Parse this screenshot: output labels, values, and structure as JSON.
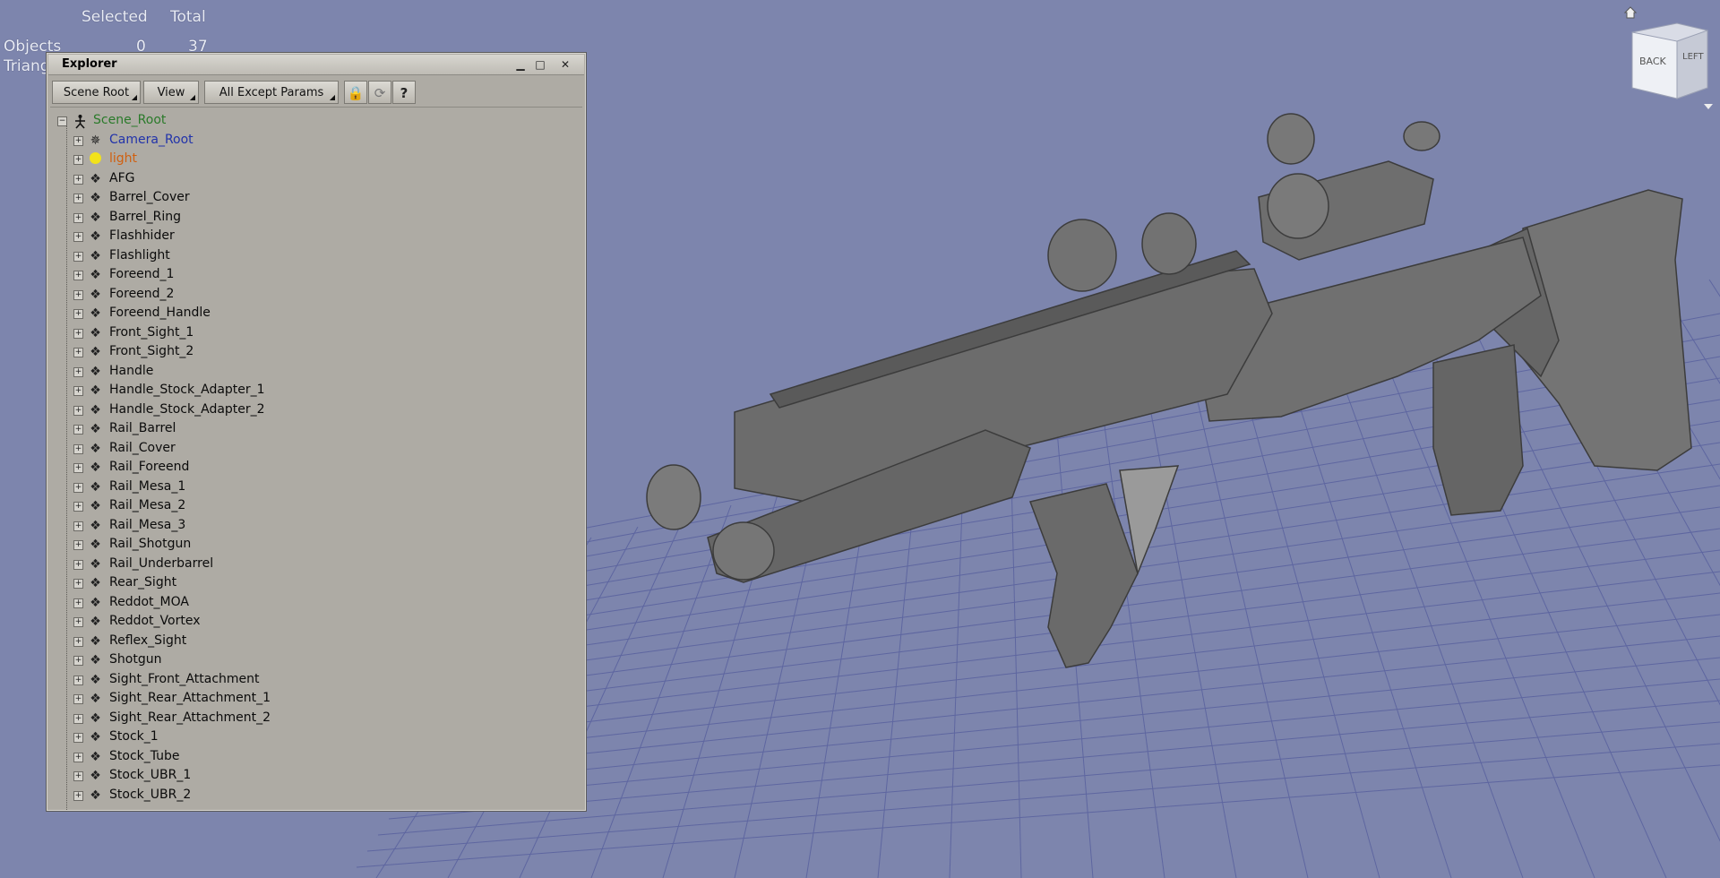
{
  "stats": {
    "col_selected": "Selected",
    "col_total": "Total",
    "objects_label": "Objects",
    "objects_selected": "0",
    "objects_total": "37",
    "triangles_label": "Triang"
  },
  "navcube": {
    "face_back": "BACK",
    "face_left": "LEFT"
  },
  "explorer": {
    "title": "Explorer",
    "toolbar": {
      "scene_root": "Scene Root",
      "view": "View",
      "filter": "All Except Params"
    },
    "root": {
      "label": "Scene_Root",
      "color": "#2a7a2a"
    },
    "items": [
      {
        "label": "Camera_Root",
        "kind": "camera",
        "color": "#2233aa"
      },
      {
        "label": "light",
        "kind": "light",
        "color": "#d06010"
      },
      {
        "label": "AFG",
        "kind": "mesh"
      },
      {
        "label": "Barrel_Cover",
        "kind": "mesh"
      },
      {
        "label": "Barrel_Ring",
        "kind": "mesh"
      },
      {
        "label": "Flashhider",
        "kind": "mesh"
      },
      {
        "label": "Flashlight",
        "kind": "mesh"
      },
      {
        "label": "Foreend_1",
        "kind": "mesh"
      },
      {
        "label": "Foreend_2",
        "kind": "mesh"
      },
      {
        "label": "Foreend_Handle",
        "kind": "mesh"
      },
      {
        "label": "Front_Sight_1",
        "kind": "mesh"
      },
      {
        "label": "Front_Sight_2",
        "kind": "mesh"
      },
      {
        "label": "Handle",
        "kind": "mesh"
      },
      {
        "label": "Handle_Stock_Adapter_1",
        "kind": "mesh"
      },
      {
        "label": "Handle_Stock_Adapter_2",
        "kind": "mesh"
      },
      {
        "label": "Rail_Barrel",
        "kind": "mesh"
      },
      {
        "label": "Rail_Cover",
        "kind": "mesh"
      },
      {
        "label": "Rail_Foreend",
        "kind": "mesh"
      },
      {
        "label": "Rail_Mesa_1",
        "kind": "mesh"
      },
      {
        "label": "Rail_Mesa_2",
        "kind": "mesh"
      },
      {
        "label": "Rail_Mesa_3",
        "kind": "mesh"
      },
      {
        "label": "Rail_Shotgun",
        "kind": "mesh"
      },
      {
        "label": "Rail_Underbarrel",
        "kind": "mesh"
      },
      {
        "label": "Rear_Sight",
        "kind": "mesh"
      },
      {
        "label": "Reddot_MOA",
        "kind": "mesh"
      },
      {
        "label": "Reddot_Vortex",
        "kind": "mesh"
      },
      {
        "label": "Reflex_Sight",
        "kind": "mesh"
      },
      {
        "label": "Shotgun",
        "kind": "mesh"
      },
      {
        "label": "Sight_Front_Attachment",
        "kind": "mesh"
      },
      {
        "label": "Sight_Rear_Attachment_1",
        "kind": "mesh"
      },
      {
        "label": "Sight_Rear_Attachment_2",
        "kind": "mesh"
      },
      {
        "label": "Stock_1",
        "kind": "mesh"
      },
      {
        "label": "Stock_Tube",
        "kind": "mesh"
      },
      {
        "label": "Stock_UBR_1",
        "kind": "mesh"
      },
      {
        "label": "Stock_UBR_2",
        "kind": "mesh"
      }
    ]
  },
  "colors": {
    "viewport_bg": "#7d85ad",
    "grid_line": "#5e66a0",
    "model_gray": "#6f6f6f",
    "panel_bg": "#aeaba4"
  }
}
